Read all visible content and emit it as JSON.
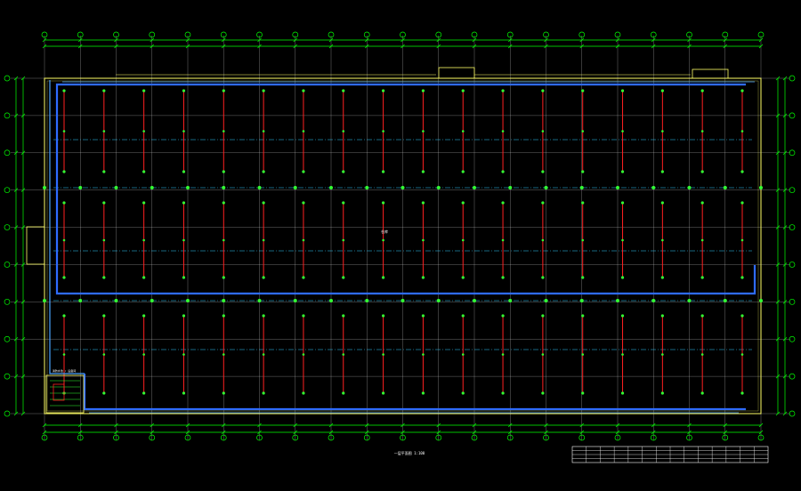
{
  "drawing": {
    "title": "一层平面图 1:100",
    "room_label": "仓库",
    "note_label": "消防水池 / 设备间",
    "legend": {
      "rows": 4,
      "cols": 14
    }
  },
  "grid": {
    "columns": 21,
    "rows": 10
  },
  "colors": {
    "background": "#000000",
    "grid": "#00ff00",
    "axis_line": "#c8c8c8",
    "wall": "#ffff66",
    "pipe": "#2f6bff",
    "pipe_light": "#4aa3ff",
    "riser": "#ff2020",
    "sprinkler": "#33ff33",
    "branch": "#33ccff",
    "text": "#ffffff"
  },
  "icons": {
    "axis_bubble": "axis-bubble-icon",
    "sprinkler_head": "sprinkler-head-icon"
  }
}
